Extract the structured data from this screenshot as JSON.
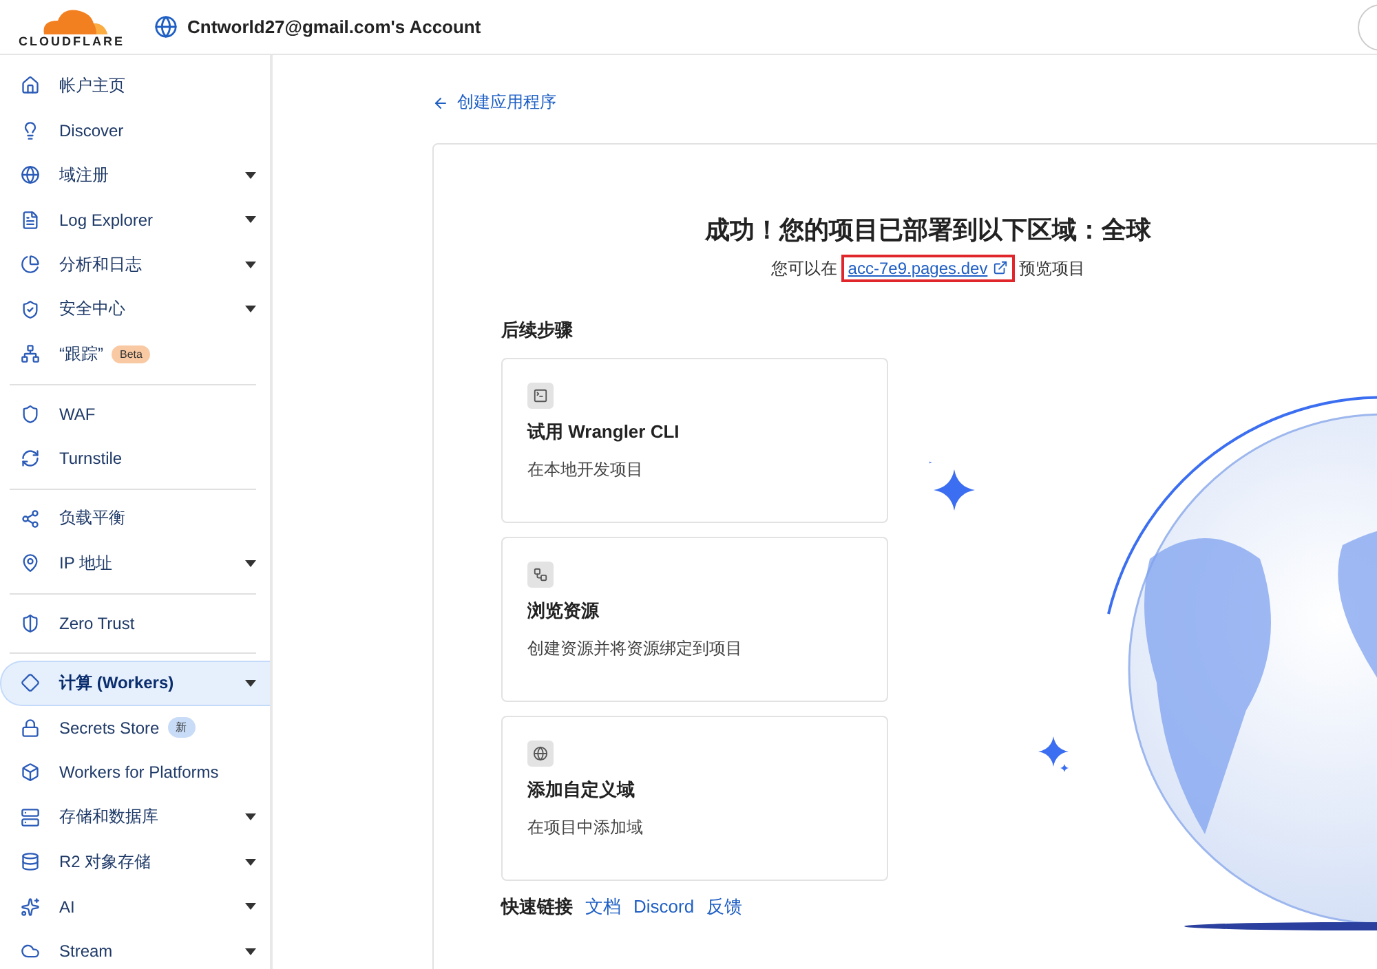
{
  "header": {
    "logo": "CLOUDFLARE",
    "account": "Cntworld27@gmail.com's Account"
  },
  "sidebar": {
    "sections": [
      [
        {
          "label": "帐户主页",
          "expandable": false,
          "selected": false
        },
        {
          "label": "Discover",
          "expandable": false,
          "selected": false
        },
        {
          "label": "域注册",
          "expandable": true,
          "selected": false
        },
        {
          "label": "Log Explorer",
          "expandable": true,
          "selected": false
        },
        {
          "label": "分析和日志",
          "expandable": true,
          "selected": false
        },
        {
          "label": "安全中心",
          "expandable": true,
          "selected": false
        },
        {
          "label": "“跟踪”",
          "expandable": false,
          "selected": false,
          "badge": {
            "text": "Beta",
            "color": "#f9c9a3"
          }
        }
      ],
      [
        {
          "label": "WAF",
          "expandable": false,
          "selected": false
        },
        {
          "label": "Turnstile",
          "expandable": false,
          "selected": false
        }
      ],
      [
        {
          "label": "负载平衡",
          "expandable": false,
          "selected": false
        },
        {
          "label": "IP 地址",
          "expandable": true,
          "selected": false
        }
      ],
      [
        {
          "label": "Zero Trust",
          "expandable": false,
          "selected": false
        }
      ],
      [
        {
          "label": "计算 (Workers)",
          "expandable": true,
          "selected": true
        },
        {
          "label": "Secrets Store",
          "expandable": false,
          "selected": false,
          "badge": {
            "text": "新",
            "color": "#c9dcf7"
          }
        },
        {
          "label": "Workers for Platforms",
          "expandable": false,
          "selected": false
        },
        {
          "label": "存储和数据库",
          "expandable": true,
          "selected": false
        },
        {
          "label": "R2 对象存储",
          "expandable": true,
          "selected": false
        },
        {
          "label": "AI",
          "expandable": true,
          "selected": false
        },
        {
          "label": "Stream",
          "expandable": true,
          "selected": false
        }
      ]
    ]
  },
  "back_link": "创建应用程序",
  "success": {
    "title": "成功！您的项目已部署到以下区域：全球",
    "preview_before": "您可以在",
    "preview_link": "acc-7e9.pages.dev",
    "preview_after": "预览项目"
  },
  "next_steps": {
    "heading": "后续步骤",
    "cards": [
      {
        "title": "试用 Wrangler CLI",
        "description": "在本地开发项目"
      },
      {
        "title": "浏览资源",
        "description": "创建资源并将资源绑定到项目"
      },
      {
        "title": "添加自定义域",
        "description": "在项目中添加域"
      }
    ]
  },
  "quick_links": {
    "label": "快速链接",
    "links": [
      "文档",
      "Discord",
      "反馈"
    ]
  }
}
